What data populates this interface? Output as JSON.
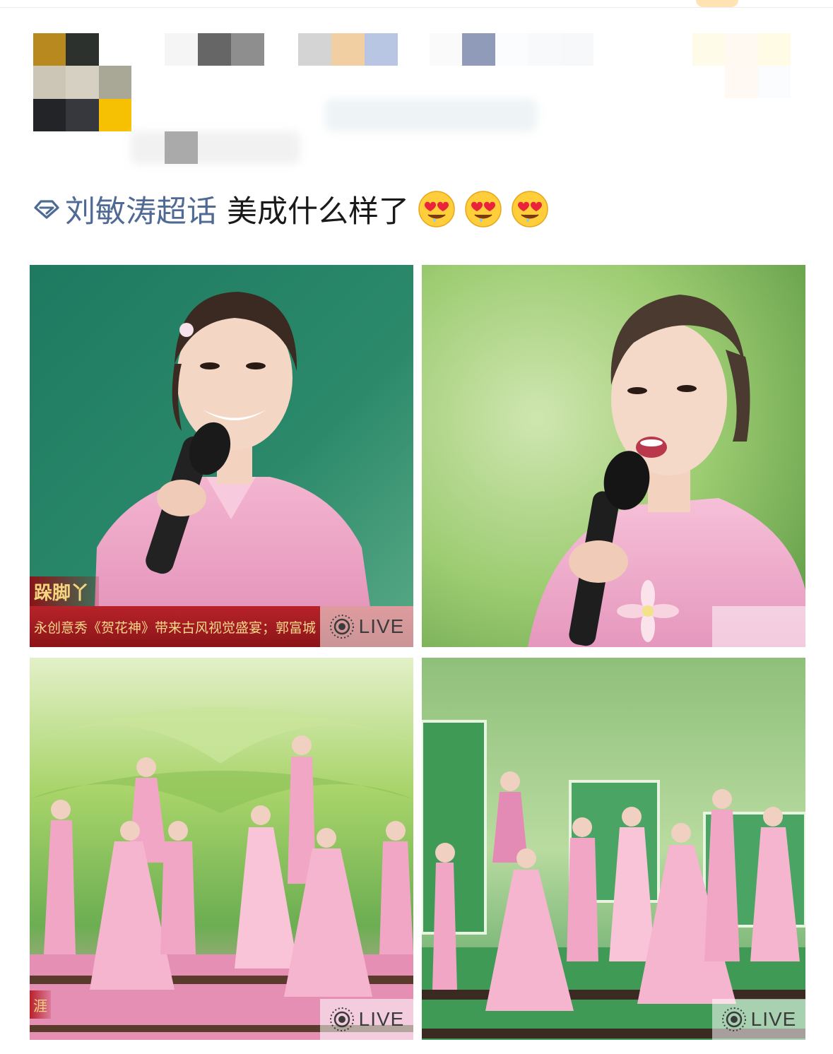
{
  "post": {
    "topic": "刘敏涛超话",
    "text": "美成什么样了"
  },
  "photos": [
    {
      "live_label": "LIVE",
      "caption_tag": "跺脚丫",
      "caption_text": "永创意秀《贺花神》带来古风视觉盛宴；郭富城"
    },
    {
      "live_label": ""
    },
    {
      "live_label": "LIVE",
      "corner_tag": "涯"
    },
    {
      "live_label": "LIVE"
    }
  ],
  "icons": {
    "topic": "super-topic-diamond-icon",
    "emoji": "heart-eyes-drooling-emoji",
    "live": "live-photo-icon"
  },
  "colors": {
    "topic_link": "#4f6a94",
    "text": "#1a1a1a",
    "caption_bar": "#b8232a",
    "caption_text": "#f7d88a"
  }
}
